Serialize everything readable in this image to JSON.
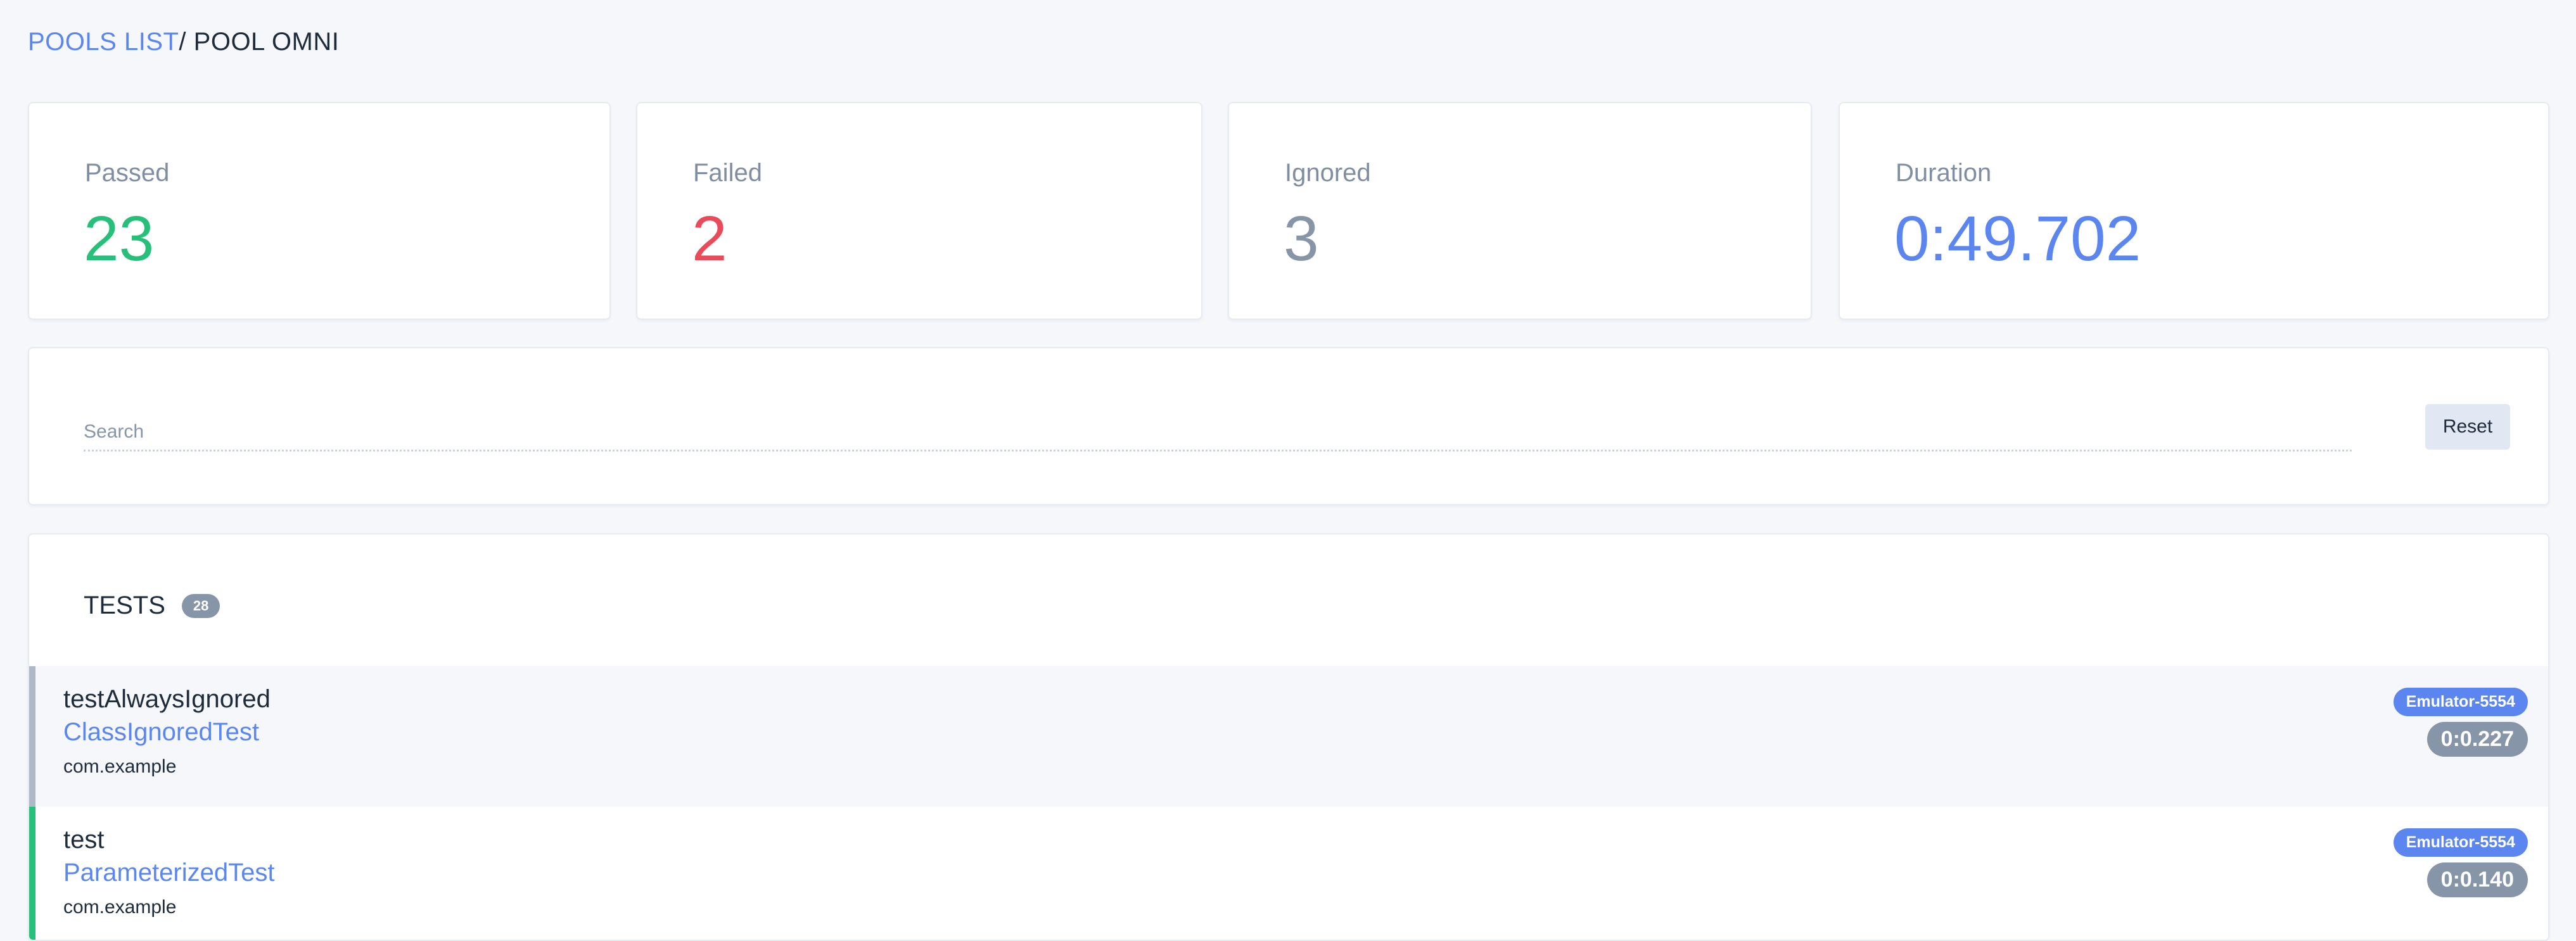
{
  "breadcrumb": {
    "pools_link": "POOLS LIST",
    "current": "/ POOL OMNI"
  },
  "stats": {
    "passed": {
      "label": "Passed",
      "value": "23"
    },
    "failed": {
      "label": "Failed",
      "value": "2"
    },
    "ignored": {
      "label": "Ignored",
      "value": "3"
    },
    "duration": {
      "label": "Duration",
      "value": "0:49.702"
    }
  },
  "search": {
    "placeholder": "Search",
    "value": "",
    "reset_label": "Reset"
  },
  "tests": {
    "title": "TESTS",
    "count": "28",
    "rows": [
      {
        "name": "testAlwaysIgnored",
        "class": "ClassIgnoredTest",
        "package": "com.example",
        "device": "Emulator-5554",
        "duration": "0:0.227",
        "status": "ignored"
      },
      {
        "name": "test",
        "class": "ParameterizedTest",
        "package": "com.example",
        "device": "Emulator-5554",
        "duration": "0:0.140",
        "status": "passed"
      }
    ]
  },
  "colors": {
    "accent": "#5b86f0",
    "passed": "#27c07a",
    "failed": "#ea4b5a",
    "ignored": "#8795a8",
    "background": "#f5f7fb"
  }
}
